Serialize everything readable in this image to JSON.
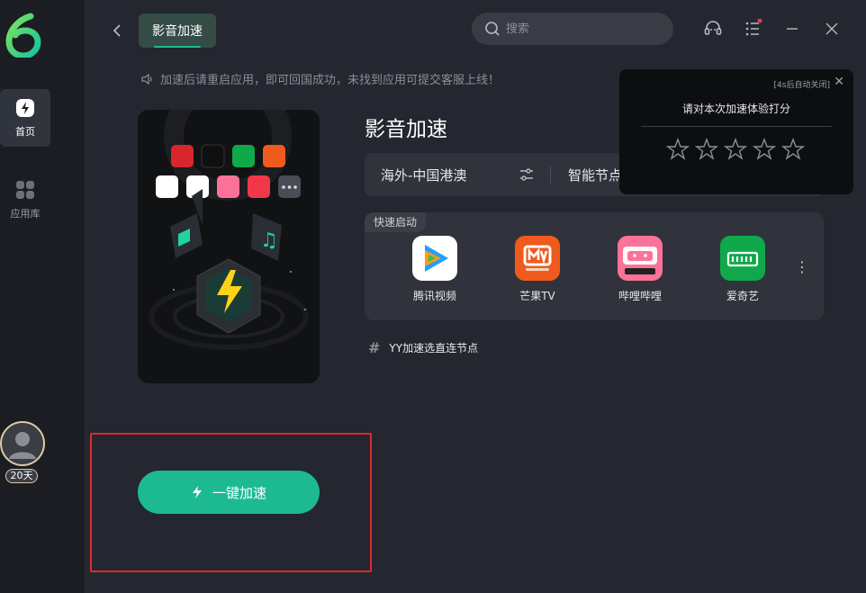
{
  "header": {
    "tab_label": "影音加速",
    "search_placeholder": "搜索"
  },
  "sidebar": {
    "items": [
      {
        "label": "首页",
        "icon": "lightning-icon",
        "active": true
      },
      {
        "label": "应用库",
        "icon": "grid-icon",
        "active": false
      }
    ],
    "avatar_badge": "20天"
  },
  "notice": "加速后请重启应用，即可回国成功，未找到应用可提交客服上线！",
  "main": {
    "title": "影音加速",
    "region": "海外-中国港澳",
    "smart_node": "智能节点",
    "quick_label": "快速启动",
    "apps": [
      {
        "name": "腾讯视频",
        "color": "#ffffff"
      },
      {
        "name": "芒果TV",
        "color": "#f05a1c"
      },
      {
        "name": "哔哩哔哩",
        "color": "#fb7299"
      },
      {
        "name": "爱奇艺",
        "color": "#00be06"
      }
    ],
    "node_hint": "YY加速选直连节点",
    "accelerate_label": "一键加速"
  },
  "popup": {
    "auto_close": "[4s后自动关闭]",
    "title": "请对本次加速体验打分",
    "stars": 5
  },
  "colors": {
    "accent": "#1dba92",
    "highlight_box": "#e02a2a"
  }
}
